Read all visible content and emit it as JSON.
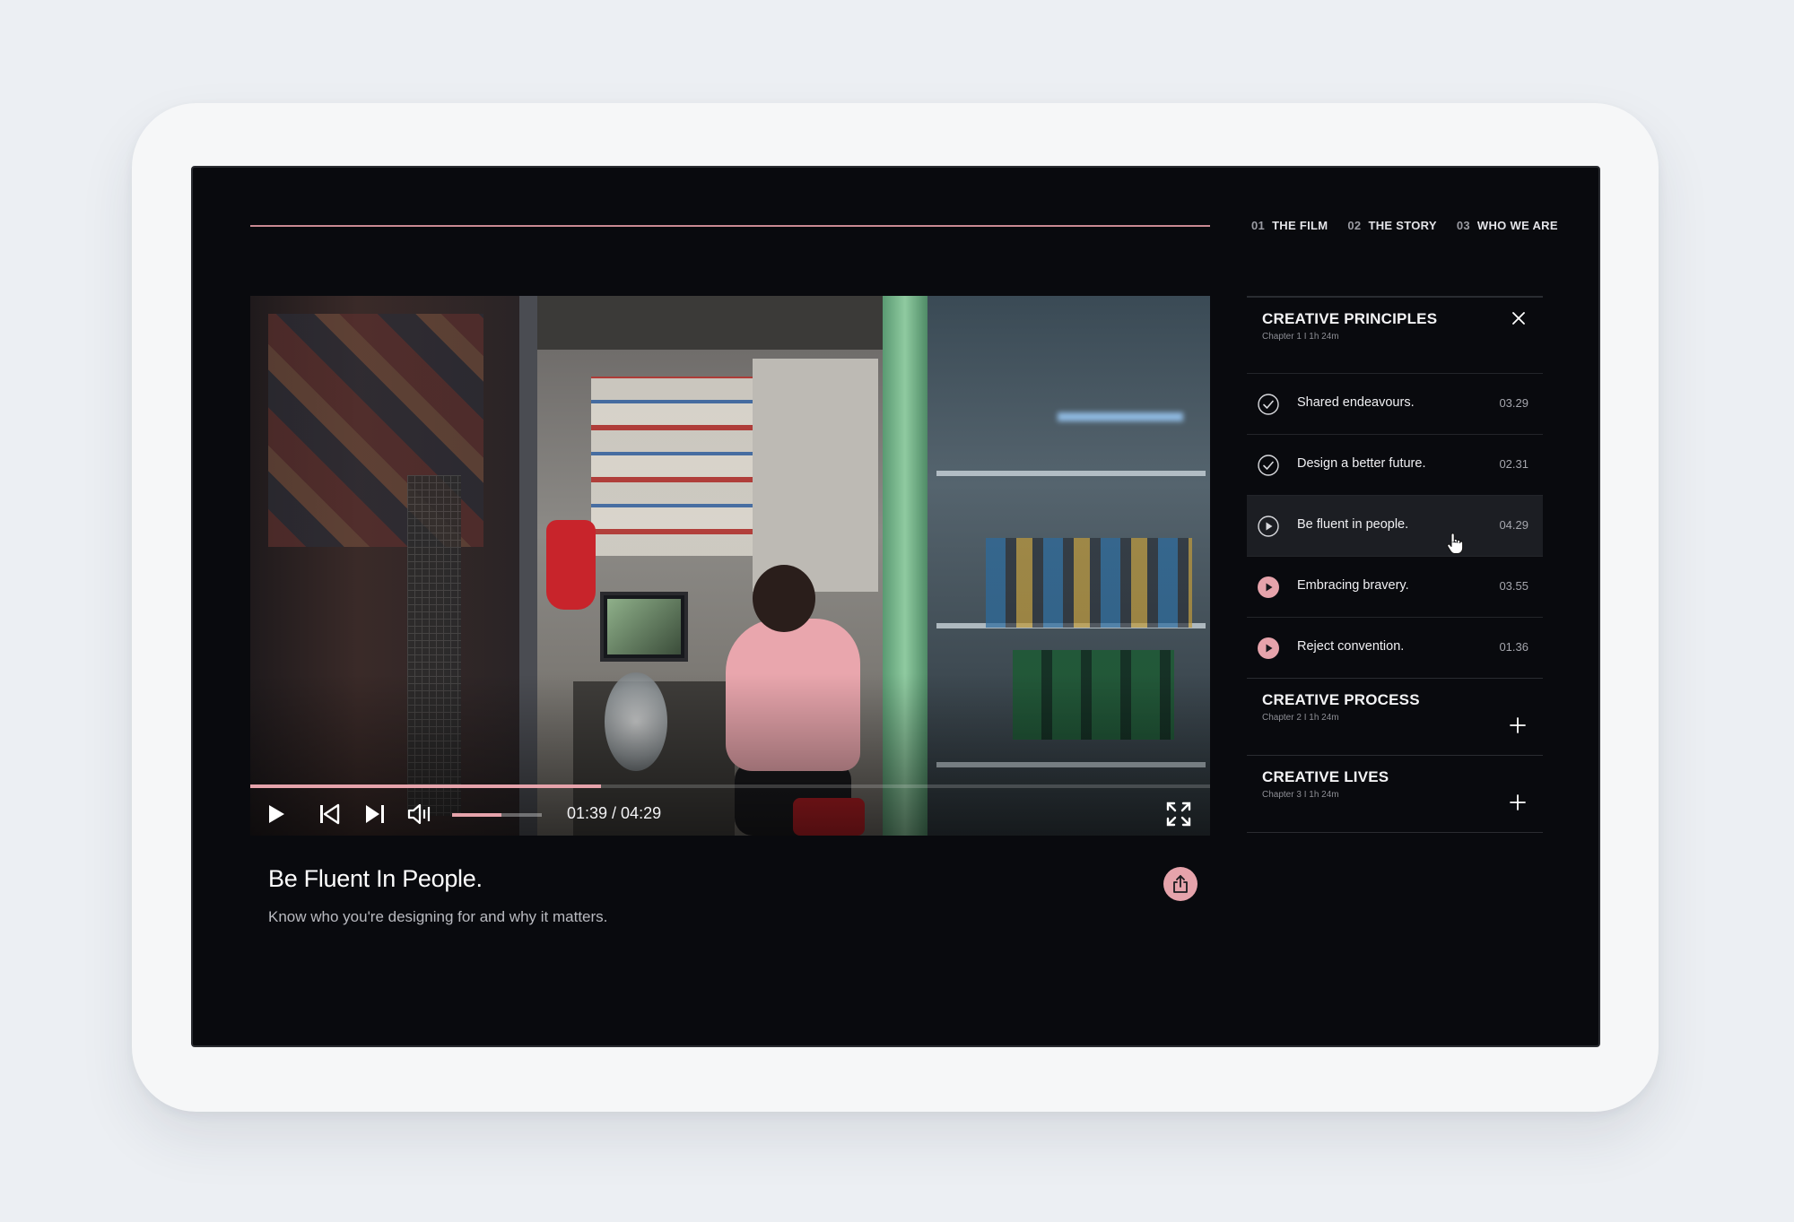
{
  "nav": [
    {
      "num": "01",
      "label": "THE FILM"
    },
    {
      "num": "02",
      "label": "THE STORY"
    },
    {
      "num": "03",
      "label": "WHO WE ARE"
    }
  ],
  "player": {
    "progress": 0.365,
    "volume": 0.55,
    "time_current": "01:39",
    "time_total": "04:29",
    "timecode": "01:39 / 04:29",
    "accent": "#e6a3ab"
  },
  "video": {
    "title": "Be Fluent In People.",
    "description": "Know who you're designing for and why it matters."
  },
  "chapters": [
    {
      "title": "CREATIVE PRINCIPLES",
      "meta": "Chapter 1  I  1h 24m",
      "expanded": true,
      "lessons": [
        {
          "label": "Shared endeavours.",
          "time": "03.29",
          "status": "completed"
        },
        {
          "label": "Design a better future.",
          "time": "02.31",
          "status": "completed"
        },
        {
          "label": "Be fluent in people.",
          "time": "04.29",
          "status": "playing"
        },
        {
          "label": "Embracing bravery.",
          "time": "03.55",
          "status": "upcoming"
        },
        {
          "label": "Reject convention.",
          "time": "01.36",
          "status": "upcoming"
        }
      ]
    },
    {
      "title": "CREATIVE PROCESS",
      "meta": "Chapter 2  I  1h 24m",
      "expanded": false
    },
    {
      "title": "CREATIVE LIVES",
      "meta": "Chapter 3  I  1h 24m",
      "expanded": false
    }
  ],
  "icons": {
    "play": "play-icon",
    "previous": "skip-previous-icon",
    "next": "skip-next-icon",
    "volume": "volume-icon",
    "fullscreen": "fullscreen-icon",
    "share": "share-icon",
    "close": "close-icon",
    "expand": "plus-icon",
    "completed": "check-circle-icon",
    "playing": "play-circle-outline-icon",
    "upcoming": "play-circle-filled-icon"
  }
}
